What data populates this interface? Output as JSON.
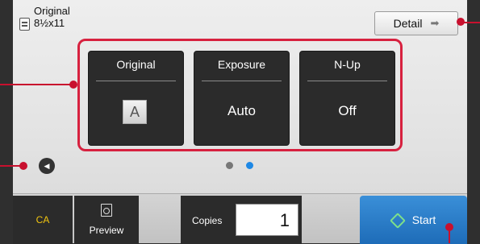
{
  "paper": {
    "line1": "Original",
    "line2": "8½x11",
    "icon": "document-icon"
  },
  "detail_button": {
    "label": "Detail",
    "icon": "arrow-right-icon"
  },
  "settings": [
    {
      "label": "Original",
      "value": "A",
      "icon": "letter-a-box"
    },
    {
      "label": "Exposure",
      "value": "Auto"
    },
    {
      "label": "N-Up",
      "value": "Off"
    }
  ],
  "pagination": {
    "total": 2,
    "current": 2,
    "inactive_color": "#777777",
    "active_color": "#1e88e5"
  },
  "bottom_bar": {
    "ca_label": "CA",
    "preview_label": "Preview",
    "copies_label": "Copies",
    "copies_value": "1",
    "start_label": "Start"
  },
  "colors": {
    "callout": "#c8102e",
    "start_button": "#2a7fd0",
    "ca_text": "#f1c40f"
  }
}
